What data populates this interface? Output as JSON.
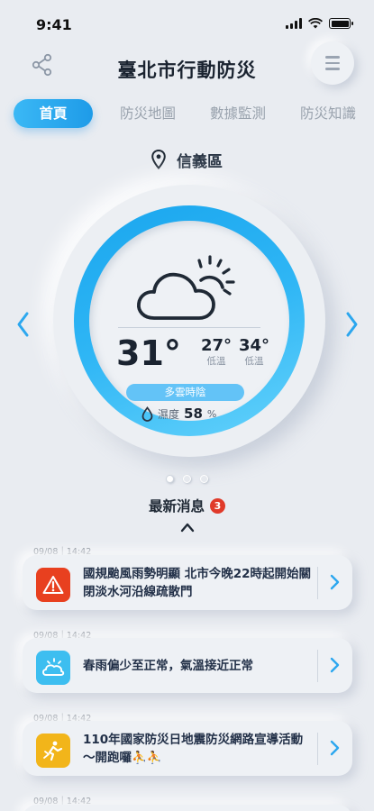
{
  "status_bar": {
    "time": "9:41"
  },
  "header": {
    "title": "臺北市行動防災"
  },
  "tabs": [
    {
      "label": "首頁",
      "active": true
    },
    {
      "label": "防災地圖",
      "active": false
    },
    {
      "label": "數據監測",
      "active": false
    },
    {
      "label": "防災知識",
      "active": false
    }
  ],
  "location": {
    "district": "信義區"
  },
  "weather": {
    "icon": "partly-cloudy-icon",
    "temperature": "31°",
    "low_value": "27°",
    "low_label": "低溫",
    "high_value": "34°",
    "high_label": "低溫",
    "condition": "多雲時陰",
    "humidity_label": "濕度",
    "humidity_value": "58",
    "humidity_unit": "%"
  },
  "carousel": {
    "pages": 3,
    "current": 1
  },
  "news": {
    "title": "最新消息",
    "count": "3",
    "items": [
      {
        "time": "09/08｜14:42",
        "text": "國規颱風雨勢明顯  北市今晚22時起開始關閉淡水河沿線疏散門",
        "icon": "warning-icon",
        "color": "#e8401f"
      },
      {
        "time": "09/08｜14:42",
        "text": "春雨偏少至正常，氣溫接近正常",
        "icon": "weather-icon",
        "color": "#3dbef0"
      },
      {
        "time": "09/08｜14:42",
        "text": "110年國家防災日地震防災網路宣導活動～開跑囉⛹⛹",
        "icon": "earthquake-icon",
        "color": "#f2b51a"
      },
      {
        "time": "09/08｜14:42"
      }
    ]
  },
  "colors": {
    "accent": "#1e9be8",
    "background": "#e9ecf1"
  }
}
